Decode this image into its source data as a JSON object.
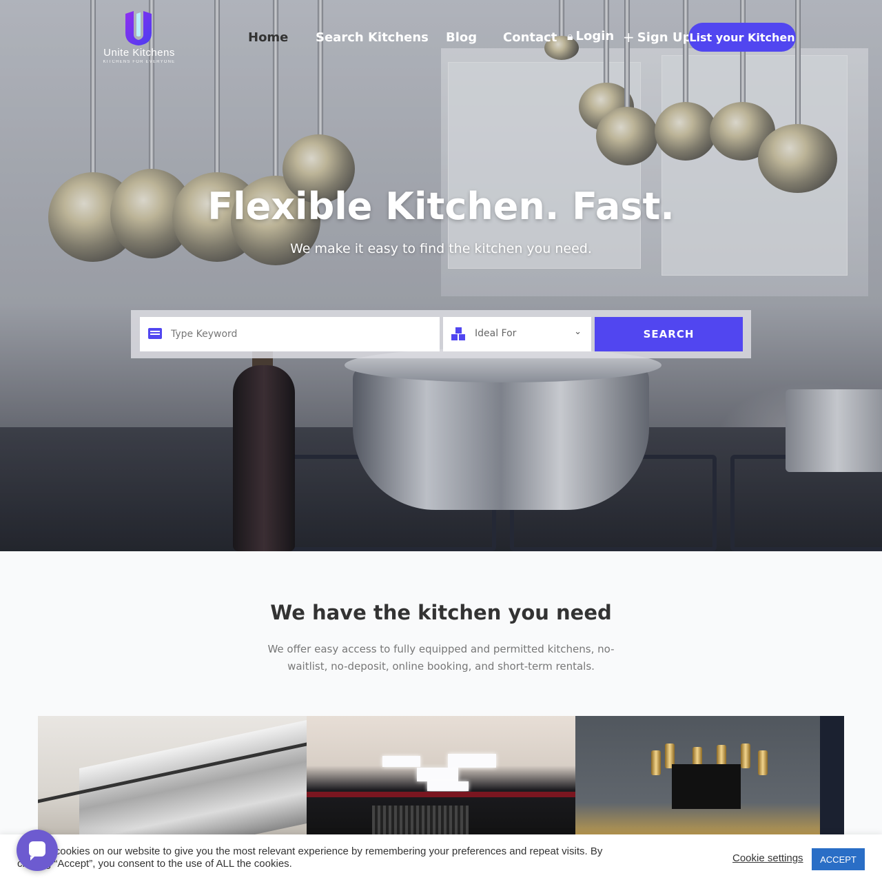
{
  "brand": {
    "name": "Unite Kitchens",
    "tagline": "KITCHENS FOR EVERYONE",
    "accent": "#5146f0"
  },
  "nav": {
    "home": "Home",
    "search_kitchens": "Search Kitchens",
    "blog": "Blog",
    "contact": "Contact",
    "login": "Login",
    "signup": "Sign Up",
    "list_kitchen": "List your Kitchen"
  },
  "hero": {
    "title": "Flexible Kitchen. Fast.",
    "subtitle": "We make it easy to find the kitchen you need."
  },
  "search": {
    "keyword_placeholder": "Type Keyword",
    "ideal_for": "Ideal For",
    "button": "SEARCH"
  },
  "section": {
    "title": "We have the kitchen you need",
    "text": "We offer easy access to fully equipped and permitted kitchens, no-waitlist, no-deposit, online booking, and short-term rentals."
  },
  "cookie": {
    "text": "We use cookies on our website to give you the most relevant experience by remembering your preferences and repeat visits. By clicking “Accept”, you consent to the use of ALL the cookies.",
    "settings": "Cookie settings",
    "accept": "ACCEPT",
    "accept_color": "#2a6ec6"
  },
  "icons": {
    "lock": "lock-icon",
    "plus": "plus-icon",
    "keyboard": "keyboard-icon",
    "boxes": "boxes-icon",
    "chevron": "chevron-down-icon",
    "chat": "chat-bubble-icon"
  }
}
